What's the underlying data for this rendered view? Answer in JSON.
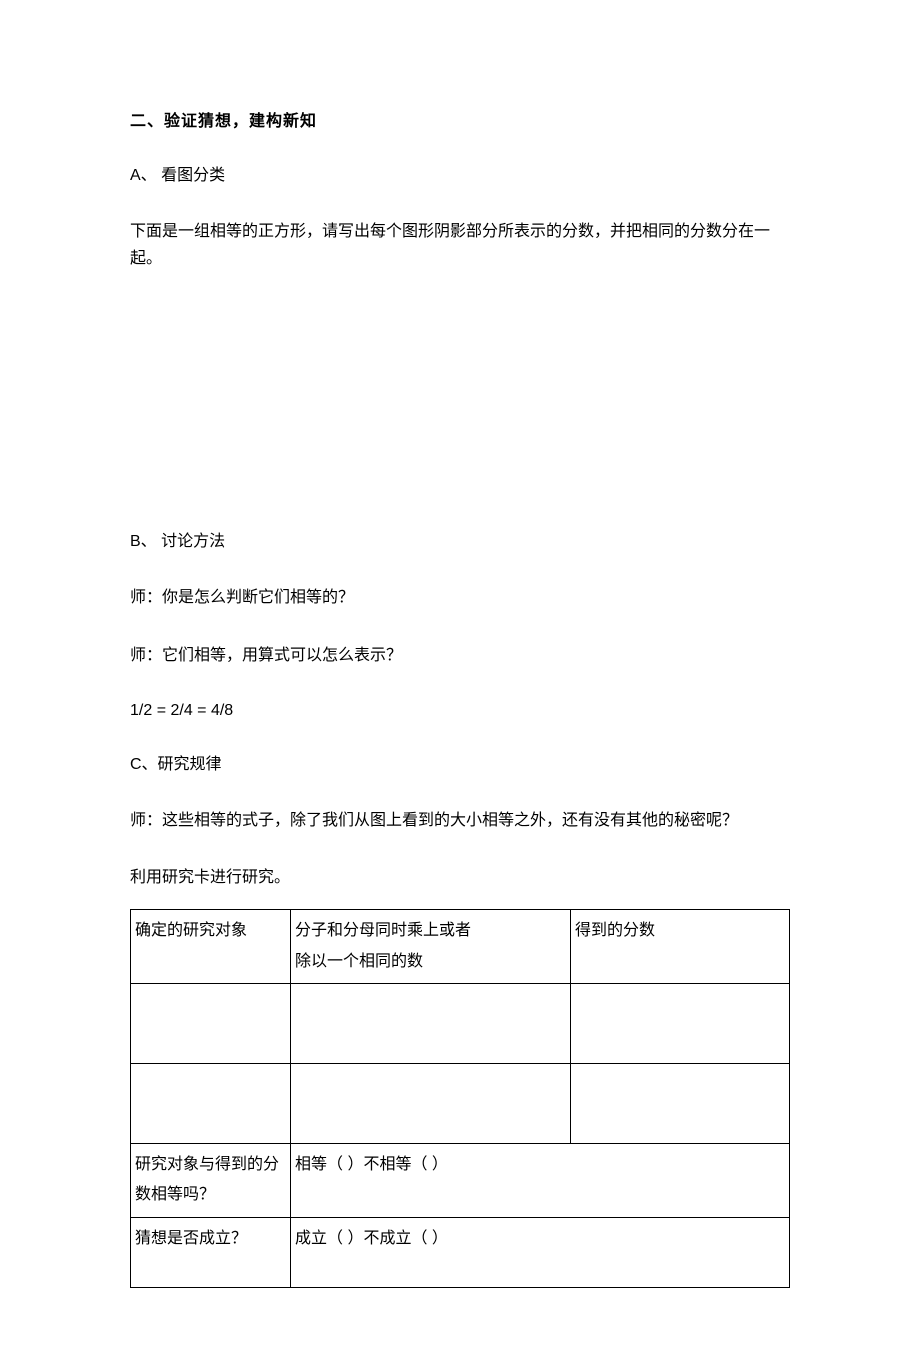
{
  "heading": "二、验证猜想，建构新知",
  "sectionA": {
    "label": "A、  看图分类",
    "intro": "下面是一组相等的正方形，请写出每个图形阴影部分所表示的分数，并把相同的分数分在一起。"
  },
  "sectionB": {
    "label": "B、  讨论方法",
    "q1": "师：你是怎么判断它们相等的？",
    "q2": "师：它们相等，用算式可以怎么表示？",
    "formula": "1/2  =  2/4  =  4/8"
  },
  "sectionC": {
    "label": "C、研究规律",
    "q1": "师：这些相等的式子，除了我们从图上看到的大小相等之外，还有没有其他的秘密呢？",
    "q2": "利用研究卡进行研究。"
  },
  "table": {
    "h1": "确定的研究对象",
    "h2_line1": "分子和分母同时乘上或者",
    "h2_line2": "除以一个相同的数",
    "h3": "得到的分数",
    "r4c1": "研究对象与得到的分数相等吗？",
    "r4c2": "相等（  ）不相等（    ）",
    "r5c1": "猜想是否成立？",
    "r5c2": "成立（   ）不成立（   ）"
  }
}
